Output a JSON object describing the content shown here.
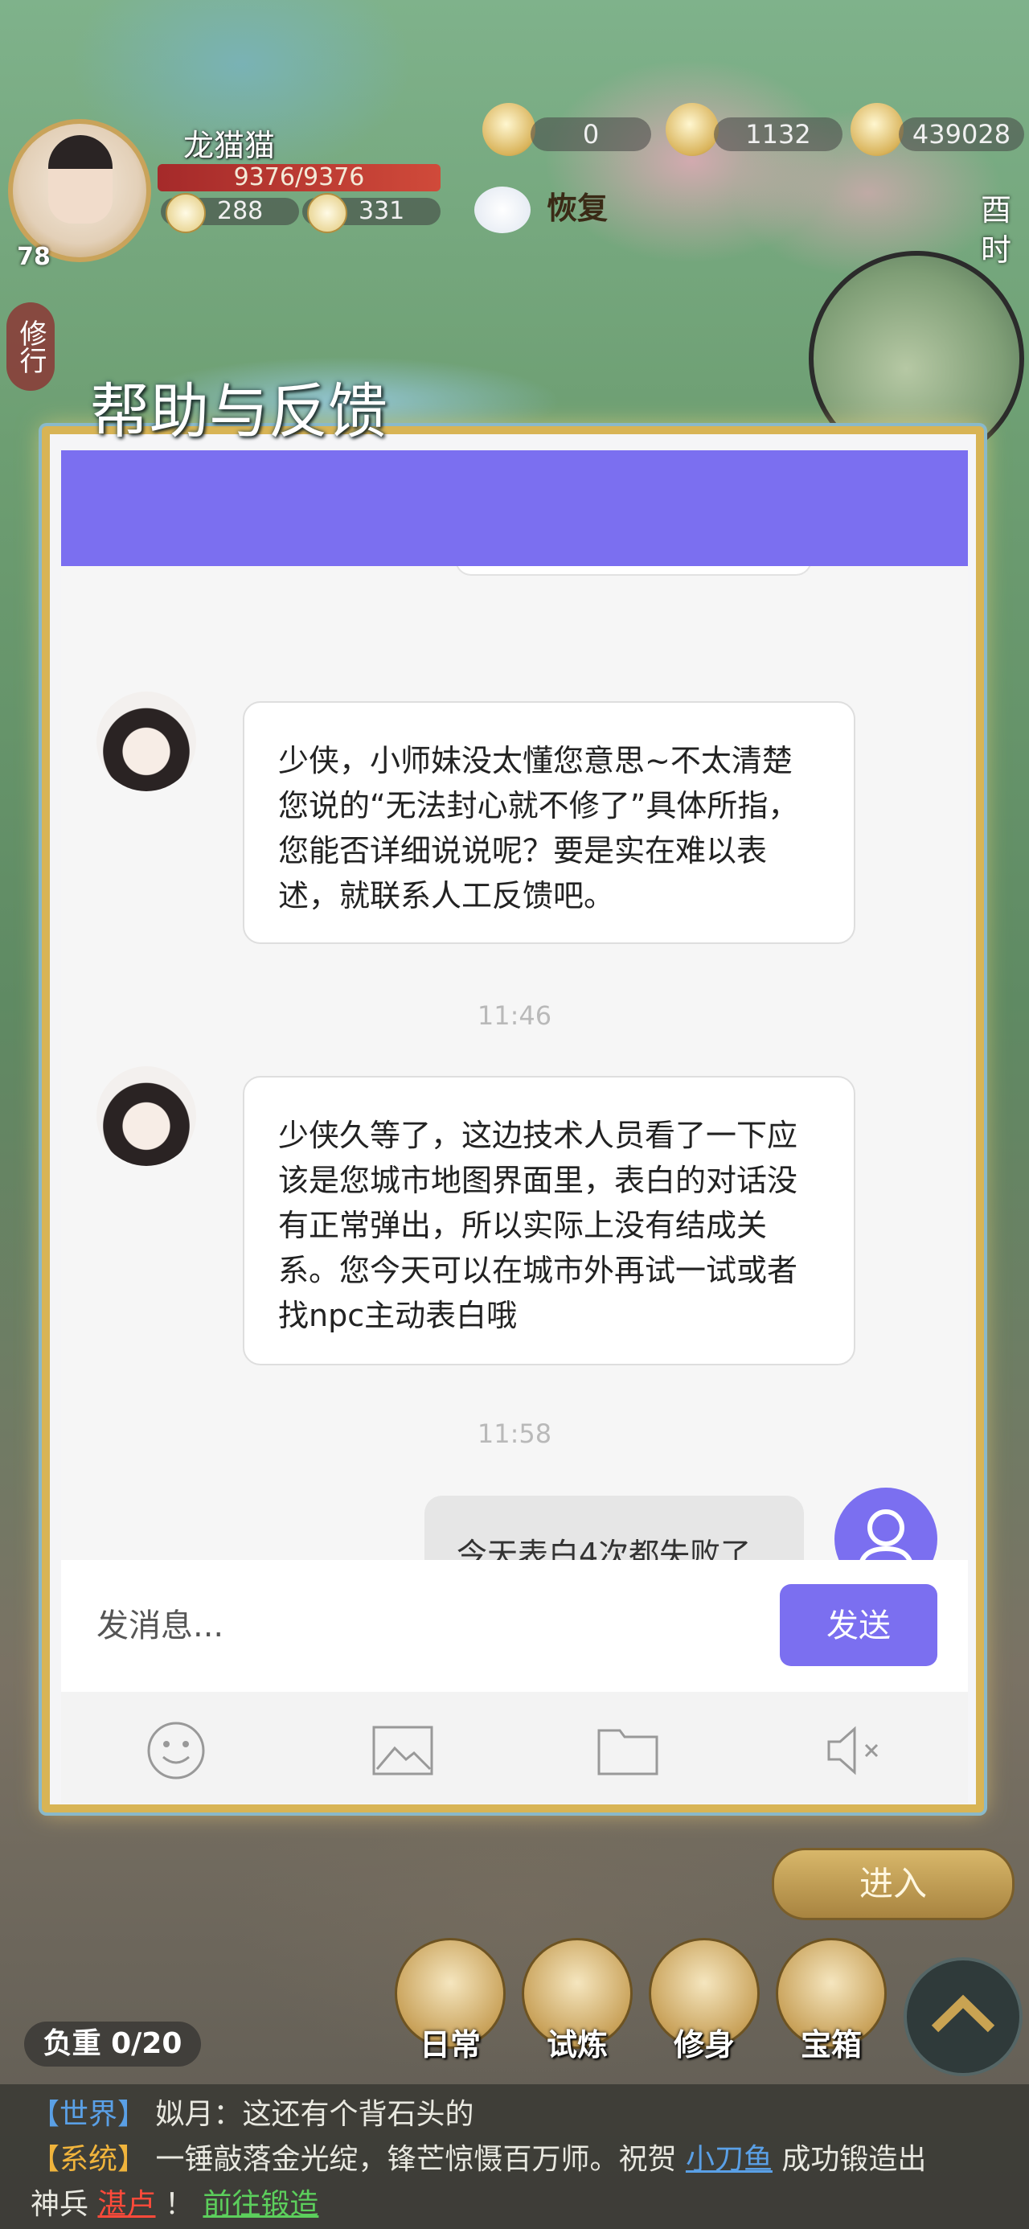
{
  "hud": {
    "player_name": "龙猫猫",
    "level": "78",
    "hp": "9376/9376",
    "stat1": "288",
    "stat2": "331",
    "resource1": "0",
    "resource2": "1132",
    "resource3": "439028",
    "recover_label": "恢复",
    "time_label": "酉时",
    "training_tab": "修行"
  },
  "dialog": {
    "title": "帮助与反馈",
    "header_color": "#7b6ff0",
    "messages": [
      {
        "sender": "agent",
        "text": "少侠，小师妹没太懂您意思~不太清楚您说的“无法封心就不修了”具体所指，您能否详细说说呢？要是实在难以表述，就联系人工反馈吧。"
      },
      {
        "timestamp": "11:46"
      },
      {
        "sender": "agent",
        "text": "少侠久等了，这边技术人员看了一下应该是您城市地图界面里，表白的对话没有正常弹出，所以实际上没有结成关系。您今天可以在城市外再试一试或者找npc主动表白哦"
      },
      {
        "timestamp": "11:58"
      },
      {
        "sender": "user",
        "text": "今天表白4次都失败了"
      }
    ],
    "input_placeholder": "发消息...",
    "send_label": "发送",
    "tools": [
      "emoji-icon",
      "image-icon",
      "folder-icon",
      "mute-icon"
    ]
  },
  "bottom": {
    "enter_label": "进入",
    "load_label": "负重 0/20",
    "menu": [
      "日常",
      "试炼",
      "修身",
      "宝箱"
    ]
  },
  "chat_feed": {
    "line1_channel": "【世界】",
    "line1_text": "姒月：这还有个背石头的",
    "line2_channel": "【系统】",
    "line2_text_a": "一锤敲落金光绽，锋芒惊慑百万师。祝贺",
    "line2_link": "小刀鱼",
    "line2_text_b": "成功锻造出",
    "line3_text_a": "神兵",
    "line3_link_red": "湛卢",
    "line3_text_b": "！",
    "line3_link_green": "前往锻造"
  }
}
